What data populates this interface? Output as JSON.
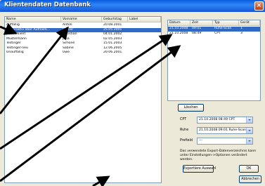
{
  "window": {
    "title": "Klientendaten Datenbank",
    "close_glyph": "×"
  },
  "clients": {
    "columns": [
      "Name",
      "Vorname",
      "Geburtstag",
      "Label"
    ],
    "rows": [
      {
        "name": "Auffällig",
        "vorname": "Anton",
        "geburtstag": "20.08.2001",
        "label": "",
        "selected": false
      },
      {
        "name": "Hyperaktiv aber Aufmerk...",
        "vorname": "Heiner",
        "geburtstag": "25.05.2001",
        "label": "",
        "selected": true
      },
      {
        "name": "Musterkient",
        "vorname": "Christian",
        "geburtstag": "04.01.2002",
        "label": "",
        "selected": false
      },
      {
        "name": "Mustermann",
        "vorname": "Julia",
        "geburtstag": "02.05.2003",
        "label": "",
        "selected": false
      },
      {
        "name": "Testinger",
        "vorname": "Simone",
        "geburtstag": "15.01.2003",
        "label": "",
        "selected": false
      },
      {
        "name": "Testinger-neu",
        "vorname": "Sabine",
        "geburtstag": "12.06.2005",
        "label": "",
        "selected": false
      },
      {
        "name": "Unauffällig",
        "vorname": "Uwe",
        "geburtstag": "20.06.2001",
        "label": "",
        "selected": false
      }
    ]
  },
  "sessions": {
    "columns": [
      "Datum",
      "Zeit",
      "Typ",
      "Gerät"
    ],
    "rows": [
      {
        "datum": "21.10.2008",
        "zeit": "09:01",
        "typ": "Ruhe-Scan",
        "geraet": "1",
        "selected": true
      },
      {
        "datum": "21.10.2008",
        "zeit": "08:49",
        "typ": "CPT",
        "geraet": "3",
        "selected": false
      }
    ]
  },
  "buttons": {
    "delete": "Löschen",
    "export_selection": "Exportiere Auswahl",
    "ok": "OK",
    "cancel": "Abbrechen"
  },
  "fields": {
    "cpt_label": "CPT",
    "cpt_value": "21.10.2008 08:49 CPT",
    "ruhe_label": "Ruhe",
    "ruhe_value": "21.10.2008 09:01 Ruhe-Scan",
    "prefield_label": "Prefield",
    "prefield_value": "---"
  },
  "info_text": "Das verwendete Export-Datenverzeichnis kann unter Einstellungen->Optionen verändert werden.",
  "colors": {
    "selection": "#316ac5",
    "titlebar": "#1457d8",
    "annotation_arrow": "#000000"
  }
}
